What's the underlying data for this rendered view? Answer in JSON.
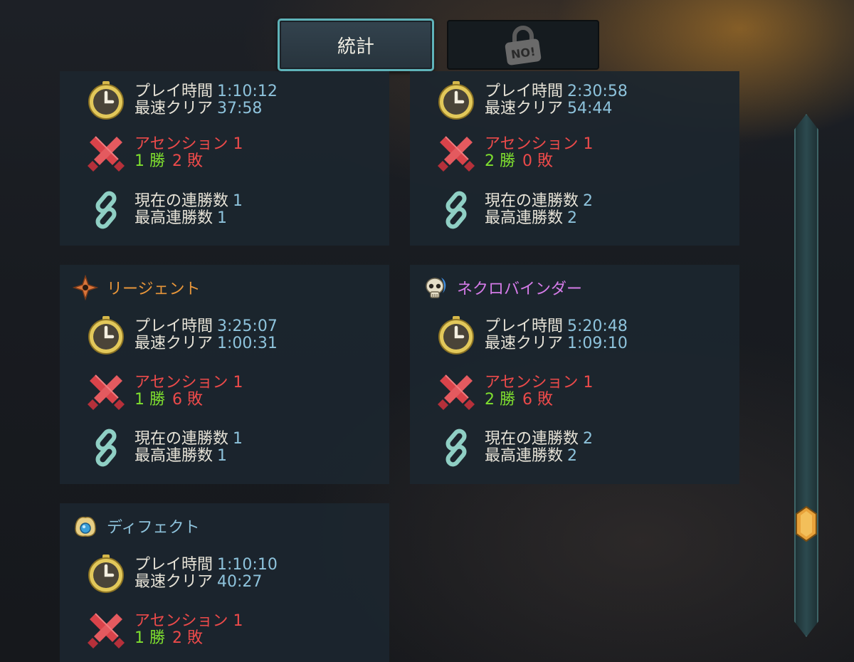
{
  "tabs": {
    "stats_label": "統計",
    "locked_label": "NO!"
  },
  "cards": [
    {
      "name": "",
      "playtime": {
        "label": "プレイ時間",
        "value": "1:10:12"
      },
      "fastest": {
        "label": "最速クリア",
        "value": "37:58"
      },
      "ascension": {
        "label": "アセンション 1",
        "wins": "1 勝",
        "losses": "2 敗"
      },
      "streak": {
        "current_label": "現在の連勝数",
        "current_value": "1",
        "best_label": "最高連勝数",
        "best_value": "1"
      }
    },
    {
      "name": "",
      "playtime": {
        "label": "プレイ時間",
        "value": "2:30:58"
      },
      "fastest": {
        "label": "最速クリア",
        "value": "54:44"
      },
      "ascension": {
        "label": "アセンション 1",
        "wins": "2 勝",
        "losses": "0 敗"
      },
      "streak": {
        "current_label": "現在の連勝数",
        "current_value": "2",
        "best_label": "最高連勝数",
        "best_value": "2"
      }
    },
    {
      "name": "リージェント",
      "name_color": "#e8963a",
      "playtime": {
        "label": "プレイ時間",
        "value": "3:25:07"
      },
      "fastest": {
        "label": "最速クリア",
        "value": "1:00:31"
      },
      "ascension": {
        "label": "アセンション 1",
        "wins": "1 勝",
        "losses": "6 敗"
      },
      "streak": {
        "current_label": "現在の連勝数",
        "current_value": "1",
        "best_label": "最高連勝数",
        "best_value": "1"
      }
    },
    {
      "name": "ネクロバインダー",
      "name_color": "#d57be8",
      "playtime": {
        "label": "プレイ時間",
        "value": "5:20:48"
      },
      "fastest": {
        "label": "最速クリア",
        "value": "1:09:10"
      },
      "ascension": {
        "label": "アセンション 1",
        "wins": "2 勝",
        "losses": "6 敗"
      },
      "streak": {
        "current_label": "現在の連勝数",
        "current_value": "2",
        "best_label": "最高連勝数",
        "best_value": "2"
      }
    },
    {
      "name": "ディフェクト",
      "name_color": "#8ec3dc",
      "playtime": {
        "label": "プレイ時間",
        "value": "1:10:10"
      },
      "fastest": {
        "label": "最速クリア",
        "value": "40:27"
      },
      "ascension": {
        "label": "アセンション 1",
        "wins": "1 勝",
        "losses": "2 敗"
      }
    }
  ],
  "colors": {
    "accent_teal": "#5fb3b9",
    "value_blue": "#8ec3dc",
    "win_green": "#7fe02f",
    "loss_red": "#ec4a4a",
    "scroll_thumb": "#e8a23a"
  },
  "scroll_position": 0.79
}
